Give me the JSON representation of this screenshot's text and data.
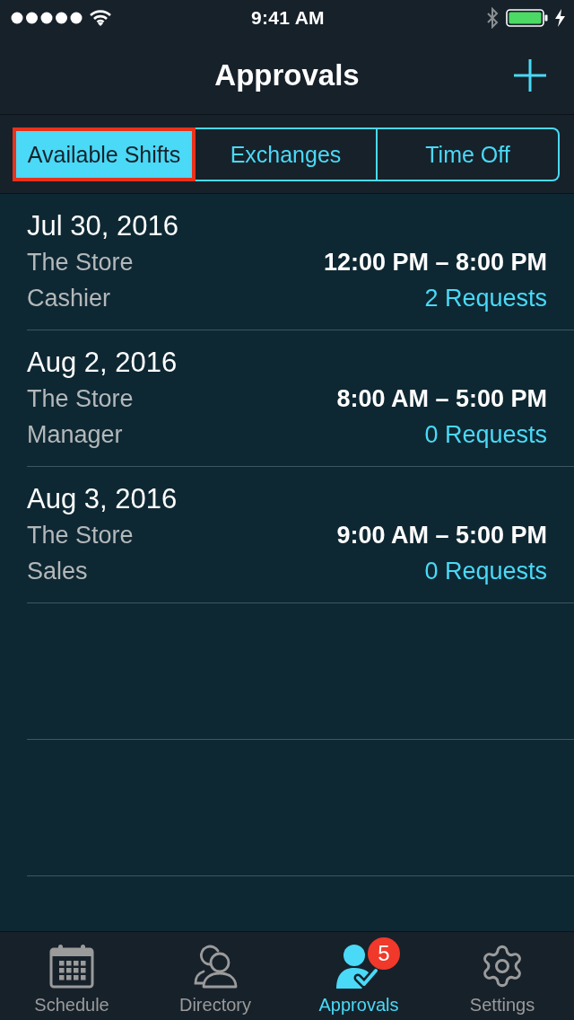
{
  "status_bar": {
    "time": "9:41 AM"
  },
  "nav_bar": {
    "title": "Approvals"
  },
  "segments": [
    {
      "label": "Available Shifts",
      "selected": true,
      "highlighted": true
    },
    {
      "label": "Exchanges",
      "selected": false,
      "highlighted": false
    },
    {
      "label": "Time Off",
      "selected": false,
      "highlighted": false
    }
  ],
  "shifts": [
    {
      "date": "Jul 30, 2016",
      "location": "The Store",
      "role": "Cashier",
      "time": "12:00 PM – 8:00 PM",
      "requests": "2 Requests"
    },
    {
      "date": "Aug 2, 2016",
      "location": "The Store",
      "role": "Manager",
      "time": "8:00 AM – 5:00 PM",
      "requests": "0 Requests"
    },
    {
      "date": "Aug 3, 2016",
      "location": "The Store",
      "role": "Sales",
      "time": "9:00 AM – 5:00 PM",
      "requests": "0 Requests"
    }
  ],
  "tab_bar": [
    {
      "kind": "calendar",
      "label": "Schedule",
      "selected": false
    },
    {
      "kind": "people",
      "label": "Directory",
      "selected": false
    },
    {
      "kind": "approval",
      "label": "Approvals",
      "selected": true,
      "badge": "5"
    },
    {
      "kind": "gear",
      "label": "Settings",
      "selected": false
    }
  ]
}
